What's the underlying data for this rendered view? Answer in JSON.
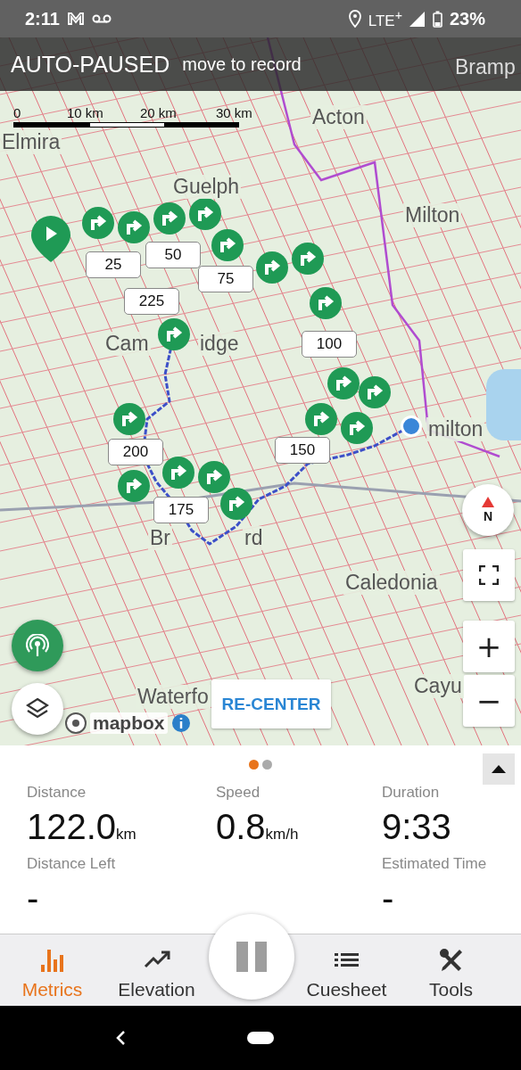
{
  "status_bar": {
    "time": "2:11",
    "network": "LTE$^{+}$",
    "battery": "23%"
  },
  "banner": {
    "title": "AUTO-PAUSED",
    "subtitle": "move to record"
  },
  "map": {
    "scale_labels": [
      "0",
      "10 km",
      "20 km",
      "30 km"
    ],
    "places": [
      "Bramp",
      "Acton",
      "Elmira",
      "Guelph",
      "Milton",
      "Cam",
      "idge",
      "milton",
      "Br",
      "rd",
      "Caledonia",
      "Cayu",
      "Waterfo"
    ],
    "distance_markers": [
      "25",
      "50",
      "75",
      "225",
      "100",
      "150",
      "200",
      "175"
    ],
    "compass": "N",
    "zoom_in": "+",
    "zoom_out": "−",
    "recenter": "RE-CENTER",
    "attribution": "mapbox"
  },
  "metrics": {
    "pages": [
      {
        "selected": true
      },
      {
        "selected": false
      }
    ],
    "items": [
      {
        "label": "Distance",
        "value": "122.0",
        "unit": "km"
      },
      {
        "label": "Speed",
        "value": "0.8",
        "unit": "km/h"
      },
      {
        "label": "Duration",
        "value": "9:33"
      },
      {
        "label": "Distance Left",
        "value": "-"
      },
      {
        "label": "Estimated Time",
        "value": "-"
      }
    ]
  },
  "tabs": [
    {
      "label": "Metrics",
      "kind": "bars",
      "selected": true
    },
    {
      "label": "Elevation",
      "kind": "trend",
      "selected": false
    },
    {
      "label": "Cuesheet",
      "kind": "list",
      "selected": false
    },
    {
      "label": "Tools",
      "kind": "tools",
      "selected": false
    }
  ]
}
